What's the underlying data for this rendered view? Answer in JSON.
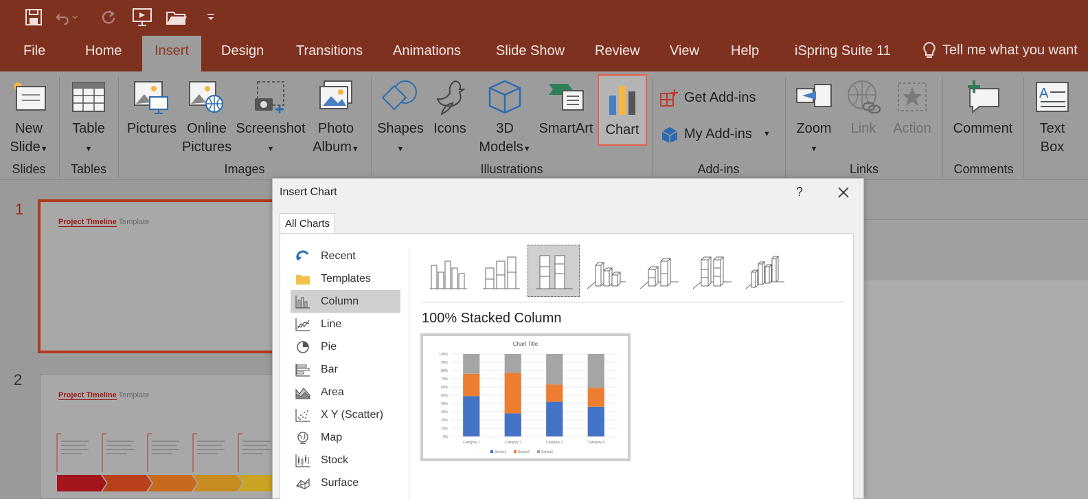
{
  "tabs": [
    "File",
    "Home",
    "Insert",
    "Design",
    "Transitions",
    "Animations",
    "Slide Show",
    "Review",
    "View",
    "Help",
    "iSpring Suite 11"
  ],
  "active_tab": "Insert",
  "tell_me": "Tell me what you want",
  "ribbon": {
    "new_slide": [
      "New",
      "Slide"
    ],
    "table": "Table",
    "pictures": "Pictures",
    "online_pictures": [
      "Online",
      "Pictures"
    ],
    "screenshot": "Screenshot",
    "photo_album": [
      "Photo",
      "Album"
    ],
    "shapes": "Shapes",
    "icons": "Icons",
    "models_3d": [
      "3D",
      "Models"
    ],
    "smartart": "SmartArt",
    "chart": "Chart",
    "get_addins": "Get Add-ins",
    "my_addins": "My Add-ins",
    "zoom": "Zoom",
    "link": "Link",
    "action": "Action",
    "comment": "Comment",
    "text_box": [
      "Text",
      "Box"
    ]
  },
  "groups": {
    "slides": "Slides",
    "tables": "Tables",
    "images": "Images",
    "illustrations": "Illustrations",
    "addins": "Add-ins",
    "links": "Links",
    "comments": "Comments"
  },
  "slides": [
    {
      "number": "1",
      "title_a": "Project Timeline",
      "title_b": "Template"
    },
    {
      "number": "2",
      "title_a": "Project Timeline",
      "title_b": "Template"
    }
  ],
  "dialog": {
    "title": "Insert Chart",
    "help": "?",
    "tab": "All Charts",
    "categories": [
      "Recent",
      "Templates",
      "Column",
      "Line",
      "Pie",
      "Bar",
      "Area",
      "X Y (Scatter)",
      "Map",
      "Stock",
      "Surface"
    ],
    "selected_category": "Column",
    "selected_subtype": "100% Stacked Column",
    "preview_title": "Chart Title"
  },
  "chart_data": {
    "type": "bar",
    "title": "Chart Title",
    "categories": [
      "Category 1",
      "Category 2",
      "Category 3",
      "Category 4"
    ],
    "y_ticks": [
      "100%",
      "90%",
      "80%",
      "70%",
      "60%",
      "50%",
      "40%",
      "30%",
      "20%",
      "10%",
      "0%"
    ],
    "ylim": [
      0,
      100
    ],
    "stacked_percent": true,
    "series": [
      {
        "name": "Series1",
        "values": [
          49,
          28,
          42,
          36
        ],
        "color": "#4472c4"
      },
      {
        "name": "Series2",
        "values": [
          27,
          49,
          21,
          23
        ],
        "color": "#ed7d31"
      },
      {
        "name": "Series3",
        "values": [
          24,
          23,
          37,
          41
        ],
        "color": "#a5a5a5"
      }
    ],
    "legend": "bottom",
    "grid": true
  },
  "colors": {
    "titlebar": "#7f311f",
    "accent": "#8e3a24",
    "chart_highlight": "#e8604a"
  }
}
